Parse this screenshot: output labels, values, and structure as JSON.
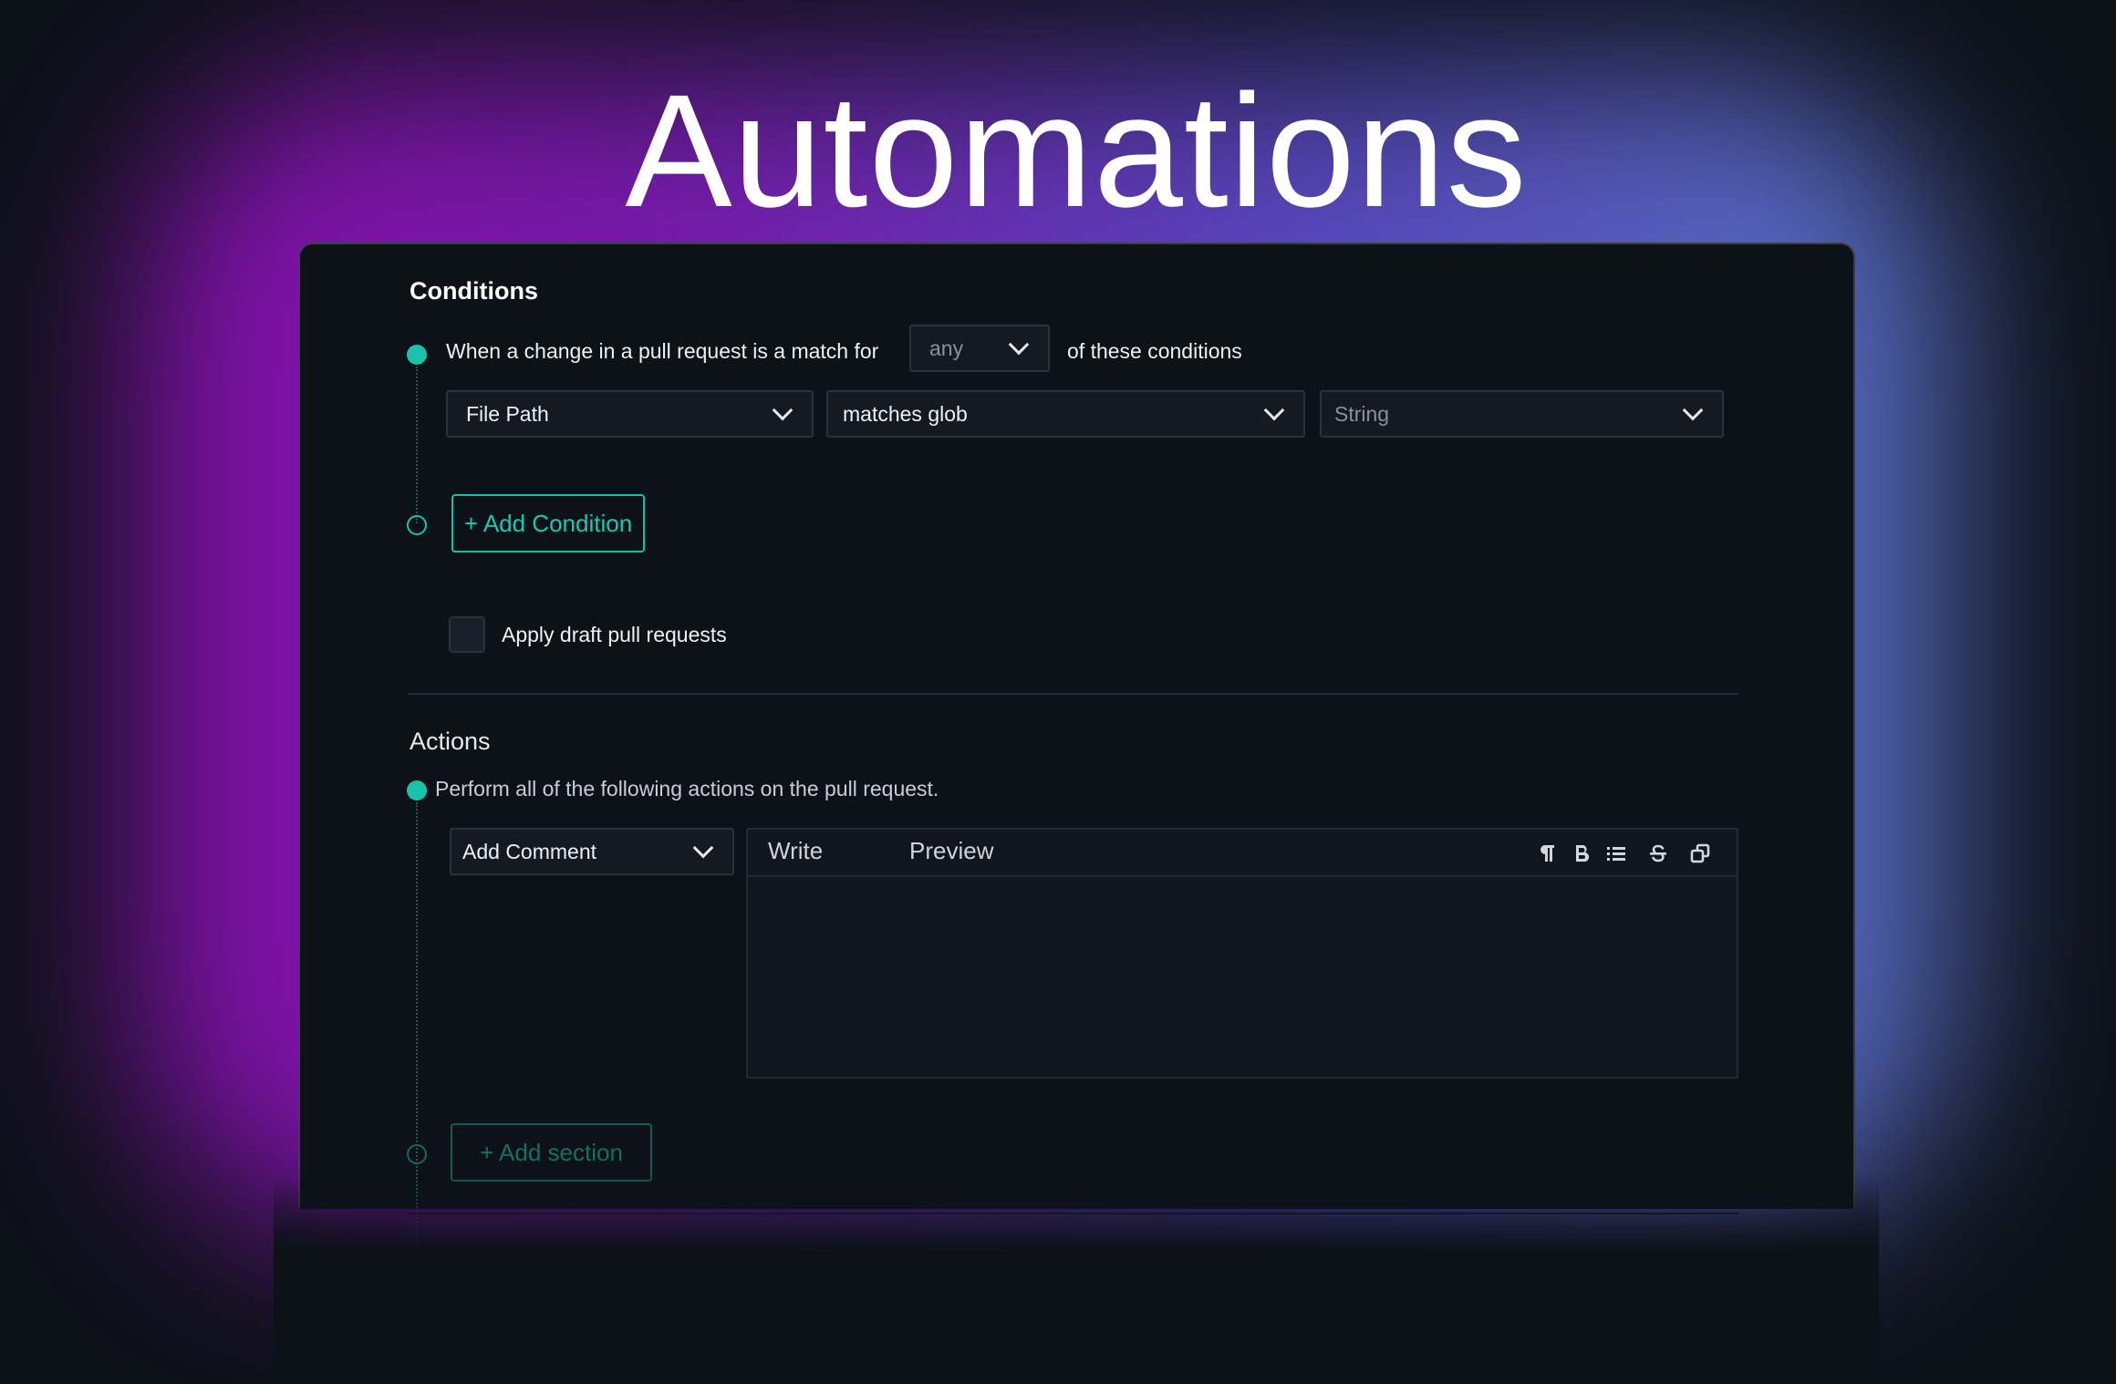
{
  "hero": {
    "title": "Automations"
  },
  "conditions": {
    "title": "Conditions",
    "sentence_prefix": "When a change in a pull request is a match for",
    "match_select": {
      "value": "any"
    },
    "sentence_suffix": "of these conditions",
    "rule": {
      "field": "File Path",
      "operator": "matches glob",
      "value_placeholder": "String"
    },
    "add_condition_label": "+ Add Condition",
    "draft_checkbox": {
      "label": "Apply draft pull requests",
      "checked": false
    }
  },
  "actions": {
    "title": "Actions",
    "description": "Perform all of the following actions on the pull request.",
    "action_select": {
      "value": "Add Comment"
    },
    "editor": {
      "tabs": [
        "Write",
        "Preview"
      ],
      "toolbar": [
        "paragraph-icon",
        "bold-icon",
        "list-icon",
        "strikethrough-icon",
        "copy-icon"
      ],
      "body": ""
    },
    "add_section_label": "+ Add section"
  },
  "colors": {
    "accent": "#1bc3ac",
    "background": "#0d1118",
    "glow_left": "#8a0fb0",
    "glow_right": "#5a74c8"
  }
}
